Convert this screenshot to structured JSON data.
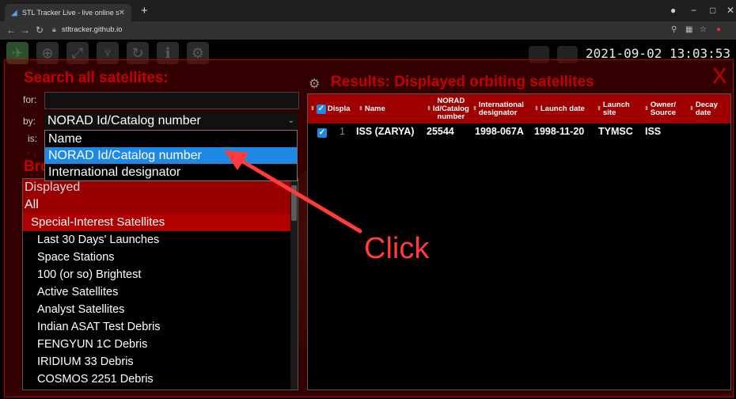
{
  "browser": {
    "tab_title": "STL Tracker Live - live online sate",
    "url": "stltracker.github.io"
  },
  "app": {
    "clock": "2021-09-02 13:03:53",
    "close_label": "X",
    "search": {
      "title": "Search all satellites:",
      "for_label": "for:",
      "by_label": "by:",
      "is_label": "is:",
      "by_value": "NORAD Id/Catalog number",
      "options": [
        "Name",
        "NORAD Id/Catalog number",
        "International designator"
      ],
      "selected_index": 1
    },
    "browse": {
      "title_visible": "Bro",
      "items": [
        {
          "label": "Displayed",
          "kind": "displayed"
        },
        {
          "label": "All",
          "kind": "all"
        },
        {
          "label": "Special-Interest Satellites",
          "kind": "group"
        },
        {
          "label": "Last 30 Days' Launches",
          "kind": "sub"
        },
        {
          "label": "Space Stations",
          "kind": "sub"
        },
        {
          "label": "100 (or so) Brightest",
          "kind": "sub"
        },
        {
          "label": "Active Satellites",
          "kind": "sub"
        },
        {
          "label": "Analyst Satellites",
          "kind": "sub"
        },
        {
          "label": "Indian ASAT Test Debris",
          "kind": "sub"
        },
        {
          "label": "FENGYUN 1C Debris",
          "kind": "sub"
        },
        {
          "label": "IRIDIUM 33 Debris",
          "kind": "sub"
        },
        {
          "label": "COSMOS 2251 Debris",
          "kind": "sub"
        }
      ]
    },
    "results": {
      "title": "Results: Displayed orbiting satellites",
      "columns": [
        "Displa",
        "Name",
        "NORAD Id/Catalog number",
        "International designator",
        "Launch date",
        "Launch site",
        "Owner/ Source",
        "Decay date"
      ],
      "rows": [
        {
          "index": "1",
          "name": "ISS (ZARYA)",
          "norad": "25544",
          "intl": "1998-067A",
          "launch_date": "1998-11-20",
          "site": "TYMSC",
          "owner": "ISS",
          "decay": ""
        }
      ]
    }
  },
  "annotation": {
    "text": "Click",
    "color": "#ff3b3b"
  }
}
